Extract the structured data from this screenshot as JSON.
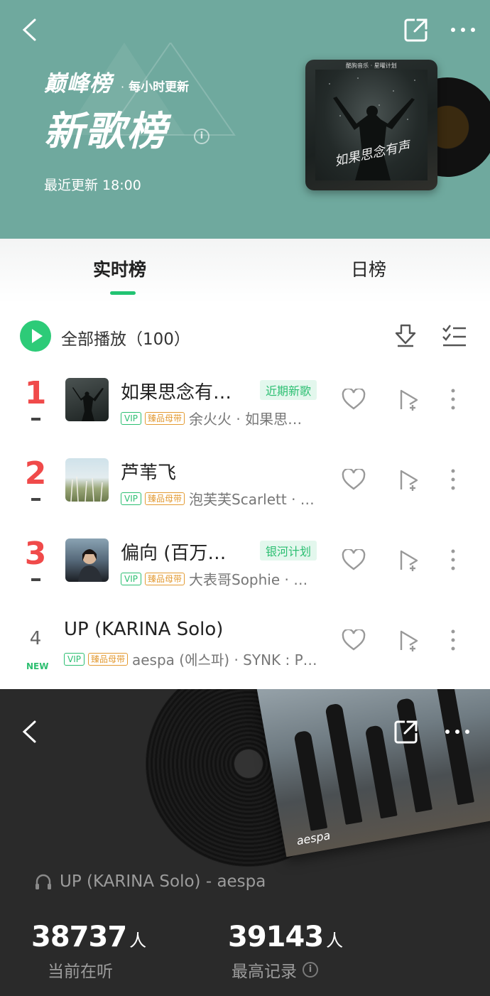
{
  "header": {
    "brand": "巅峰榜",
    "dot": "·",
    "frequency": "每小时更新",
    "title": "新歌榜",
    "updated": "最近更新 18:00",
    "cover_caption": "酷狗音乐 · 星曜计划",
    "cover_script": "如果思念有声"
  },
  "tabs": [
    {
      "label": "实时榜",
      "active": true
    },
    {
      "label": "日榜",
      "active": false
    }
  ],
  "play_all": {
    "label": "全部播放（100）"
  },
  "songs": [
    {
      "rank": "1",
      "title": "如果思念有…",
      "tag": "近期新歌",
      "vip": "VIP",
      "quality": "臻品母带",
      "artist": "余火火 · 如果思…",
      "trend": "-"
    },
    {
      "rank": "2",
      "title": "芦苇飞",
      "tag": "",
      "vip": "VIP",
      "quality": "臻品母带",
      "artist": "泡芙芙Scarlett · …",
      "trend": "-"
    },
    {
      "rank": "3",
      "title": "偏向 (百万…",
      "tag": "银河计划",
      "vip": "VIP",
      "quality": "臻品母带",
      "artist": "大表哥Sophie · …",
      "trend": "-"
    },
    {
      "rank": "4",
      "title": "UP (KARINA Solo)",
      "tag": "",
      "vip": "VIP",
      "quality": "臻品母带",
      "artist": "aespa (에스파) · SYNK : P…",
      "trend": "NEW"
    }
  ],
  "player": {
    "now_playing": "UP (KARINA Solo) - aespa",
    "photo_brand": "aespa",
    "current_listeners": "38737",
    "current_unit": "人",
    "current_label": "当前在听",
    "record_listeners": "39143",
    "record_unit": "人",
    "record_label": "最高记录"
  },
  "colors": {
    "header_bg": "#6fa99e",
    "accent_green": "#2dcb78",
    "rank_red": "#f04a4a",
    "quality_orange": "#e39a32",
    "player_bg": "#2a2a2a"
  }
}
